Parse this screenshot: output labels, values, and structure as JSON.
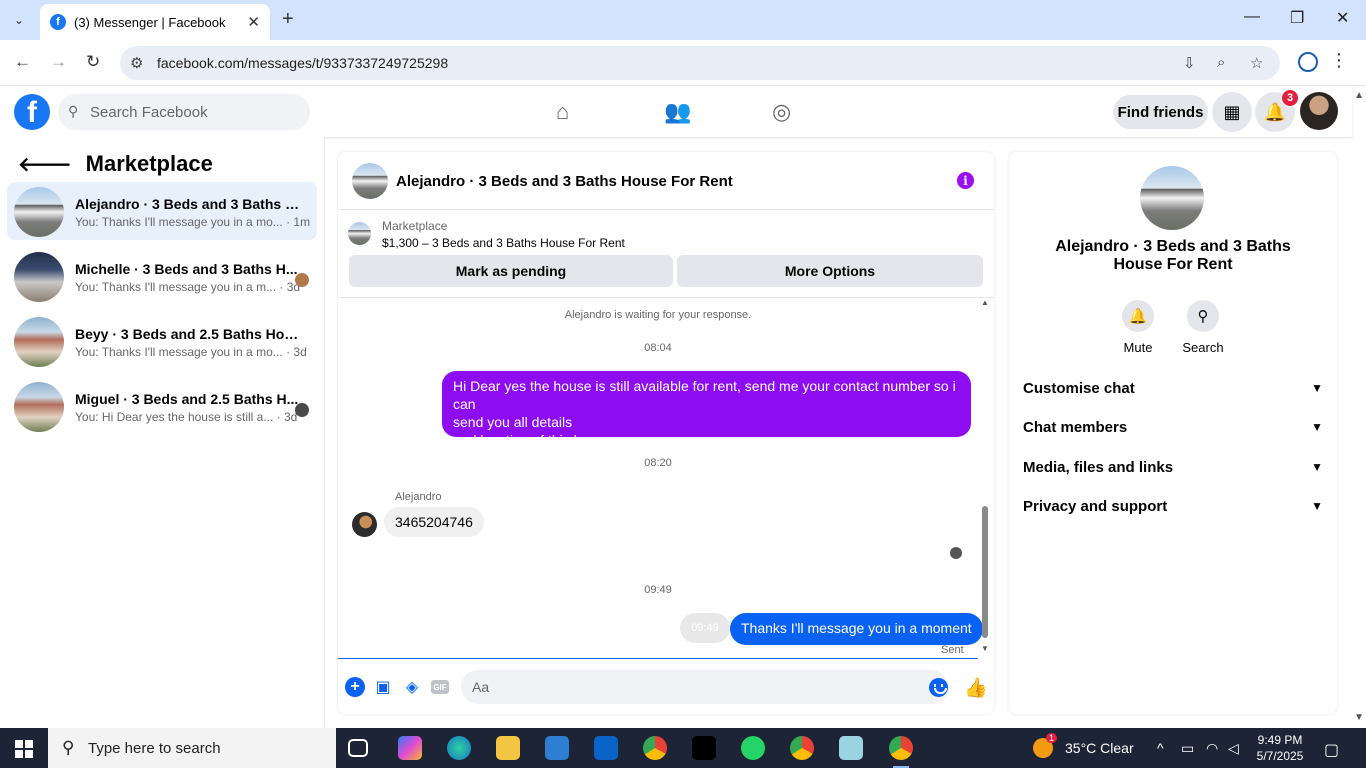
{
  "browser": {
    "tab_title": "(3) Messenger | Facebook",
    "url": "facebook.com/messages/t/9337337249725298"
  },
  "fb": {
    "search_placeholder": "Search Facebook",
    "find_friends": "Find friends",
    "notification_count": "3"
  },
  "left": {
    "title": "Marketplace",
    "conversations": [
      {
        "name": "Alejandro · 3 Beds and 3 Baths Ho...",
        "preview": "You: Thanks I'll message you in a mo...",
        "time": "· 1m",
        "active": true
      },
      {
        "name": "Michelle · 3 Beds and 3 Baths H...",
        "preview": "You: Thanks I'll message you in a m...",
        "time": "· 3d",
        "active": false
      },
      {
        "name": "Beyy · 3 Beds and 2.5 Baths House...",
        "preview": "You: Thanks I'll message you in a mo...",
        "time": "· 3d",
        "active": false
      },
      {
        "name": "Miguel · 3 Beds and 2.5 Baths H...",
        "preview": "You: Hi Dear yes the house is still a...",
        "time": "· 3d",
        "active": false
      }
    ]
  },
  "chat": {
    "title": "Alejandro · 3 Beds and 3 Baths House For Rent",
    "marketplace_label": "Marketplace",
    "listing": "$1,300 – 3 Beds and 3 Baths House For Rent",
    "mark_pending": "Mark as pending",
    "more_options": "More Options",
    "waiting": "Alejandro is waiting for your response.",
    "time1": "08:04",
    "msg_out_1_line1": "Hi Dear yes the house is still available for rent, send me your contact number so i can",
    "msg_out_1_line2": "send you all details",
    "msg_out_1_line3": "and location of this house",
    "time2": "08:20",
    "sender": "Alejandro",
    "msg_in_1": "3465204746",
    "time3": "09:49",
    "msg_out_2": "Thanks I'll message you in a moment",
    "time_chip": "09:49",
    "sent": "Sent",
    "composer_placeholder": "Aa"
  },
  "right": {
    "title": "Alejandro · 3 Beds and 3 Baths House For Rent",
    "mute": "Mute",
    "search": "Search",
    "sections": [
      "Customise chat",
      "Chat members",
      "Media, files and links",
      "Privacy and support"
    ]
  },
  "taskbar": {
    "search_placeholder": "Type here to search",
    "weather": "35°C  Clear",
    "time": "9:49 PM",
    "date": "5/7/2025",
    "weather_alert": "1"
  }
}
